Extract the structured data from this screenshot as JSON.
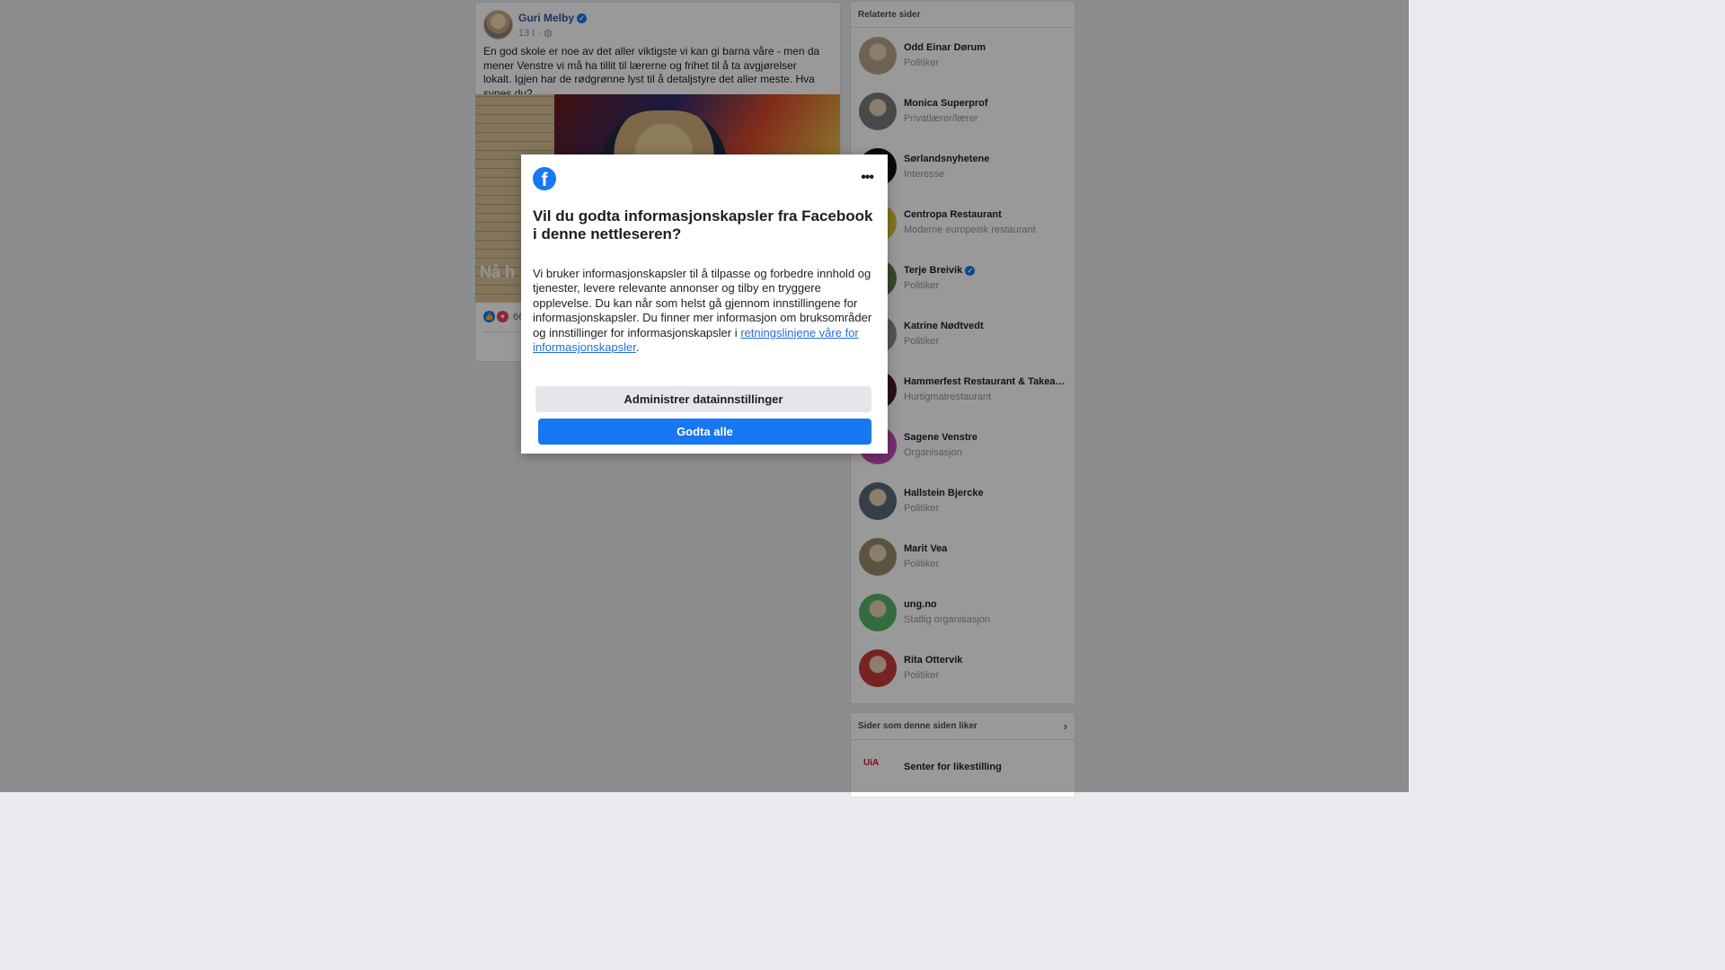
{
  "post": {
    "author": "Guri Melby",
    "time": "13 t ·",
    "text": "En god skole er noe av det aller viktigste vi kan gi barna våre - men da mener Venstre vi må ha tillit til lærerne og frihet til å ta avgjørelser lokalt. Igjen har de rødgrønne lyst til å detaljstyre det aller meste. Hva synes du?",
    "image_caption": "Nå h",
    "reaction_count": "66"
  },
  "related_pages": {
    "header": "Relaterte sider",
    "items": [
      {
        "name": "Odd Einar Dørum",
        "category": "Politiker",
        "color": "#b8a48a"
      },
      {
        "name": "Monica Superprof",
        "category": "Privatlærer/lærer",
        "color": "#7a7a7a"
      },
      {
        "name": "Sørlandsnyhetene",
        "category": "Interesse",
        "color": "#111111"
      },
      {
        "name": "Centropa Restaurant",
        "category": "Moderne europeisk restaurant",
        "color": "#d8c43a"
      },
      {
        "name": "Terje Breivik",
        "category": "Politiker",
        "color": "#5a7a4a",
        "verified": true
      },
      {
        "name": "Katrine Nødtvedt",
        "category": "Politiker",
        "color": "#8f8f8f"
      },
      {
        "name": "Hammerfest Restaurant & Takeaway",
        "category": "Hurtigmatrestaurant",
        "color": "#4a1a2a"
      },
      {
        "name": "Sagene Venstre",
        "category": "Organisasjon",
        "color": "#c84ab8"
      },
      {
        "name": "Hallstein Bjercke",
        "category": "Politiker",
        "color": "#5a6a7a"
      },
      {
        "name": "Marit Vea",
        "category": "Politiker",
        "color": "#9a8a6a"
      },
      {
        "name": "ung.no",
        "category": "Statlig organisasjon",
        "color": "#56b46a"
      },
      {
        "name": "Rita Ottervik",
        "category": "Politiker",
        "color": "#c83a3a"
      }
    ]
  },
  "liked_pages": {
    "header": "Sider som denne siden liker",
    "items": [
      {
        "name": "Senter for likestilling",
        "logo_text": "UiA"
      }
    ]
  },
  "cookie_dialog": {
    "title": "Vil du godta informasjonskapsler fra Facebook i denne nettleseren?",
    "body": "Vi bruker informasjonskapsler til å tilpasse og forbedre innhold og tjenester, levere relevante annonser og tilby en tryggere opplevelse. Du kan når som helst gå gjennom innstillingene for informasjonskapsler. Du finner mer informasjon om bruksområder og innstillinger for informasjonskapsler i ",
    "link": "retningslinjene våre for informasjonskapsler",
    "body_end": ".",
    "manage_button": "Administrer datainnstillinger",
    "accept_button": "Godta alle"
  },
  "icons": {
    "facebook_logo": "f",
    "more": "•••",
    "globe": "◍",
    "chevron": "›",
    "verified": "✓",
    "like": "👍",
    "love": "♥"
  },
  "colors": {
    "facebook_blue": "#1877f2",
    "link": "#216fdb",
    "author": "#385898"
  }
}
